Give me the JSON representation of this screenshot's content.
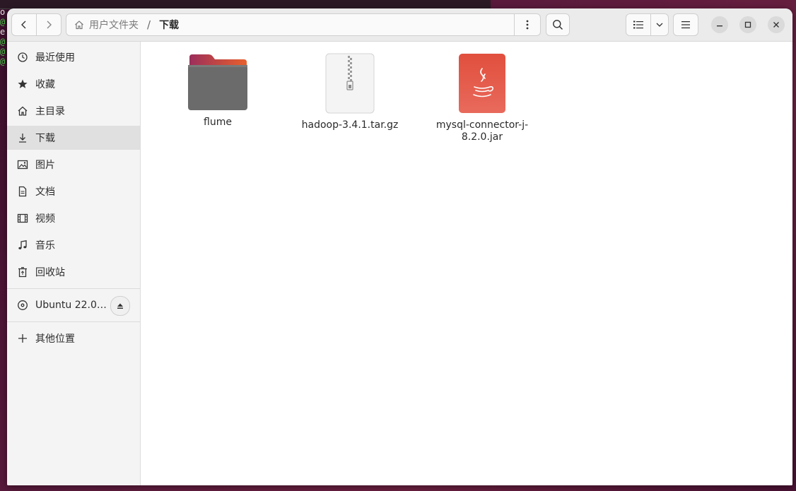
{
  "window": {
    "title": "下载"
  },
  "background_terminal": {
    "lines": [
      "op",
      "@l",
      "e/",
      "@l",
      "@l",
      "@l"
    ]
  },
  "pathbar": {
    "home_label": "用户文件夹",
    "separator": "/",
    "current": "下载"
  },
  "sidebar": {
    "items": [
      {
        "label": "最近使用",
        "icon": "clock-icon"
      },
      {
        "label": "收藏",
        "icon": "star-icon"
      },
      {
        "label": "主目录",
        "icon": "home-icon"
      },
      {
        "label": "下载",
        "icon": "download-icon",
        "active": true
      },
      {
        "label": "图片",
        "icon": "image-icon"
      },
      {
        "label": "文档",
        "icon": "document-icon"
      },
      {
        "label": "视频",
        "icon": "film-icon"
      },
      {
        "label": "音乐",
        "icon": "music-icon"
      },
      {
        "label": "回收站",
        "icon": "trash-icon"
      }
    ],
    "device": {
      "label": "Ubuntu 22.0…",
      "icon": "disc-icon"
    },
    "other": {
      "label": "其他位置",
      "icon": "plus-icon"
    }
  },
  "files": [
    {
      "name": "flume",
      "type": "folder"
    },
    {
      "name": "hadoop-3.4.1.tar.gz",
      "type": "archive"
    },
    {
      "name": "mysql-connector-j-8.2.0.jar",
      "name_line1": "mysql-connector-j-",
      "name_line2": "8.2.0.jar",
      "type": "java"
    }
  ],
  "colors": {
    "folder_top": "#c0405a",
    "folder_body": "#6e6e6e",
    "java_bg": "#e0574a",
    "active_row": "#e0e0e0"
  }
}
